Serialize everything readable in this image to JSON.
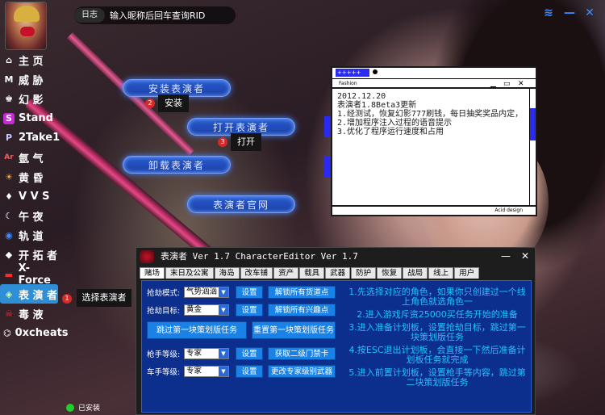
{
  "topbar": {
    "log_label": "日志",
    "search_placeholder": "输入昵称后回车查询RID"
  },
  "sidebar": {
    "items": [
      {
        "label": "主 页",
        "icon": "home-icon",
        "glyph": "⌂"
      },
      {
        "label": "威 胁",
        "icon": "threat-icon",
        "glyph": "M"
      },
      {
        "label": "幻 影",
        "icon": "phantom-icon",
        "glyph": "♚"
      },
      {
        "label": "Stand",
        "icon": "stand-icon",
        "glyph": "S"
      },
      {
        "label": "2Take1",
        "icon": "2take1-icon",
        "glyph": "P"
      },
      {
        "label": "氩 气",
        "icon": "argon-icon",
        "glyph": "Ar"
      },
      {
        "label": "黄 昏",
        "icon": "dusk-icon",
        "glyph": "☀"
      },
      {
        "label": "V V S",
        "icon": "diamond-icon",
        "glyph": "♦"
      },
      {
        "label": "午 夜",
        "icon": "midnight-icon",
        "glyph": "☾"
      },
      {
        "label": "轨 道",
        "icon": "orbit-icon",
        "glyph": "◉"
      },
      {
        "label": "开 拓 者",
        "icon": "pioneer-icon",
        "glyph": "◆"
      },
      {
        "label": "X-Force",
        "icon": "xforce-icon",
        "glyph": "▬"
      },
      {
        "label": "表 演 者",
        "icon": "performer-icon",
        "glyph": "◈"
      },
      {
        "label": "毒 液",
        "icon": "venom-icon",
        "glyph": "☠"
      },
      {
        "label": "0xcheats",
        "icon": "oxcheats-icon",
        "glyph": "⌬"
      }
    ],
    "tip_badge": "1",
    "tip_text": "选择表演者"
  },
  "status": {
    "text": "已安装"
  },
  "actions": {
    "install": "安装表演者",
    "open": "打开表演者",
    "uninstall": "卸载表演者",
    "website": "表演者官网",
    "tip_install_badge": "2",
    "tip_install": "安装",
    "tip_open_badge": "3",
    "tip_open": "打开"
  },
  "news": {
    "badge": "+++++",
    "menu": "Fashion",
    "footer": "Acid design",
    "lines": [
      "2012.12.20",
      "表演者1.8Beta3更新",
      "1.经测试，恢复幻影777刷钱，每日抽奖奖品内定，",
      "2.增加程序注入过程的语音提示",
      "3.优化了程序运行速度和占用"
    ]
  },
  "editor": {
    "title": "表演者 Ver 1.7   CharacterEditor Ver 1.7",
    "tabs": [
      "赌场",
      "末日及公寓",
      "海岛",
      "改车铺",
      "资产",
      "载具",
      "武器",
      "防护",
      "恢复",
      "战局",
      "线上",
      "用户"
    ],
    "row1_label": "抢劫模式:",
    "row1_value": "气势汹汹",
    "row2_label": "抢劫目标:",
    "row2_value": "黄金",
    "row3_label": "枪手等级:",
    "row3_value": "专家",
    "row4_label": "车手等级:",
    "row4_value": "专家",
    "set_label": "设置",
    "btn_unlock_items": "解锁所有货道点",
    "btn_unlock_interest": "解锁所有兴趣点",
    "btn_skip_first": "跳过第一块策划版任务",
    "btn_reset_first": "重置第一块策划版任务",
    "btn_get_keycard": "获取二级门禁卡",
    "btn_change_weapon": "更改专家级别武器",
    "help": [
      "1.先选择对应的角色，如果你只创建过一个线上角色就选角色一",
      "2.进入游戏斥资25000买任务开始的准备",
      "3.进入准备计划板，设置抢劫目标，跳过第一块策划版任务",
      "4.按ESC退出计划板，会直接一下然后准备计划板任务就完成",
      "5.进入前置计划板，设置枪手等内容，跳过第二块策划版任务"
    ]
  }
}
